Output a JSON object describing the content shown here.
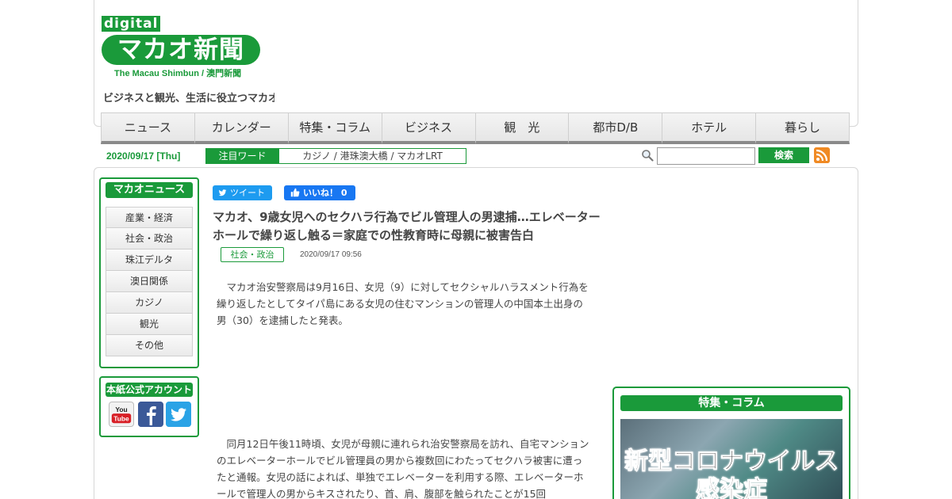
{
  "brand": {
    "logo_digital": "digital",
    "logo_main": "マカオ新聞",
    "logo_sub": "The Macau Shimbun / 澳門新聞",
    "tagline": "ビジネスと観光、生活に役立つマカオ"
  },
  "nav": [
    {
      "label": "ニュース"
    },
    {
      "label": "カレンダー"
    },
    {
      "label": "特集・コラム"
    },
    {
      "label": "ビジネス"
    },
    {
      "label": "観　光"
    },
    {
      "label": "都市D/B"
    },
    {
      "label": "ホテル"
    },
    {
      "label": "暮らし"
    }
  ],
  "topbar": {
    "date": "2020/09/17 [Thu]",
    "hot_label": "注目ワード",
    "hot_words": "カジノ / 港珠澳大橋 / マカオLRT",
    "search_value": "",
    "search_button": "検索"
  },
  "sidebar": {
    "title": "マカオニュース",
    "items": [
      {
        "label": "産業・経済"
      },
      {
        "label": "社会・政治"
      },
      {
        "label": "珠江デルタ"
      },
      {
        "label": "澳日関係"
      },
      {
        "label": "カジノ"
      },
      {
        "label": "観光"
      },
      {
        "label": "その他"
      }
    ],
    "accounts_title": "本紙公式アカウント",
    "youtube_label": "You Tube",
    "facebook_label": "f"
  },
  "social": {
    "tweet": "ツイート",
    "like": "いいね！ 0"
  },
  "article": {
    "title": "マカオ、9歳女児へのセクハラ行為でビル管理人の男逮捕…エレベーターホールで繰り返し触る＝家庭での性教育時に母親に被害告白",
    "category": "社会・政治",
    "date": "2020/09/17 09:56",
    "paragraph1": "　マカオ治安警察局は9月16日、女児（9）に対してセクシャルハラスメント行為を繰り返したとしてタイパ島にある女児の住むマンションの管理人の中国本土出身の男（30）を逮捕したと発表。",
    "paragraph2": "　同月12日午後11時頃、女児が母親に連れられ治安警察局を訪れ、自宅マンションのエレベーターホールでビル管理員の男から複数回にわたってセクハラ被害に遭ったと通報。女児の話によれば、単独でエレベーターを利用する際、エレベーターホールで管理人の男からキスされたり、首、肩、腹部を触られたことが15回"
  },
  "feature": {
    "title": "特集・コラム",
    "image_text": "新型コロナウイルス\n感染症"
  },
  "colors": {
    "brand_green": "#1a9a3a",
    "rss_orange": "#f08a24"
  }
}
